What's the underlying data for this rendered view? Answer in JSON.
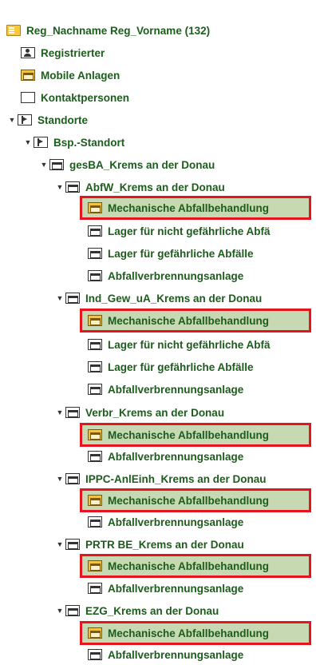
{
  "tree": {
    "root": {
      "label": "Reg_Nachname Reg_Vorname (132)",
      "icon": "register-icon"
    },
    "items": {
      "registrierter": {
        "label": "Registrierter",
        "icon": "person-card-icon"
      },
      "mobile": {
        "label": "Mobile Anlagen",
        "icon": "facility-icon"
      },
      "kontakt": {
        "label": "Kontaktpersonen",
        "icon": "empty-box-icon"
      },
      "standorte": {
        "label": "Standorte",
        "icon": "flag-icon"
      },
      "bsp_standort": {
        "label": "Bsp.-Standort",
        "icon": "flag-icon"
      },
      "gesba": {
        "label": "gesBA_Krems an der Donau",
        "icon": "facility-icon"
      }
    },
    "groups": [
      {
        "label": "AbfW_Krems an der Donau",
        "children": [
          {
            "label": "Mechanische Abfallbehandlung",
            "selected": true
          },
          {
            "label": "Lager für nicht gefährliche Abfä",
            "selected": false
          },
          {
            "label": "Lager für gefährliche Abfälle",
            "selected": false
          },
          {
            "label": "Abfallverbrennungsanlage",
            "selected": false
          }
        ]
      },
      {
        "label": "Ind_Gew_uA_Krems an der Donau",
        "children": [
          {
            "label": "Mechanische Abfallbehandlung",
            "selected": true
          },
          {
            "label": "Lager für nicht gefährliche Abfä",
            "selected": false
          },
          {
            "label": "Lager für gefährliche Abfälle",
            "selected": false
          },
          {
            "label": "Abfallverbrennungsanlage",
            "selected": false
          }
        ]
      },
      {
        "label": "Verbr_Krems an der Donau",
        "children": [
          {
            "label": "Mechanische Abfallbehandlung",
            "selected": true
          },
          {
            "label": "Abfallverbrennungsanlage",
            "selected": false
          }
        ]
      },
      {
        "label": "IPPC-AnlEinh_Krems an der Donau",
        "children": [
          {
            "label": "Mechanische Abfallbehandlung",
            "selected": true
          },
          {
            "label": "Abfallverbrennungsanlage",
            "selected": false
          }
        ]
      },
      {
        "label": "PRTR BE_Krems an der Donau",
        "children": [
          {
            "label": "Mechanische Abfallbehandlung",
            "selected": true
          },
          {
            "label": "Abfallverbrennungsanlage",
            "selected": false
          }
        ]
      },
      {
        "label": "EZG_Krems an der Donau",
        "children": [
          {
            "label": "Mechanische Abfallbehandlung",
            "selected": true
          },
          {
            "label": "Abfallverbrennungsanlage",
            "selected": false
          }
        ]
      }
    ],
    "colors": {
      "text": "#1d5c1d",
      "selected_bg": "#c7d9b2",
      "highlight_border": "#e4151f"
    }
  }
}
